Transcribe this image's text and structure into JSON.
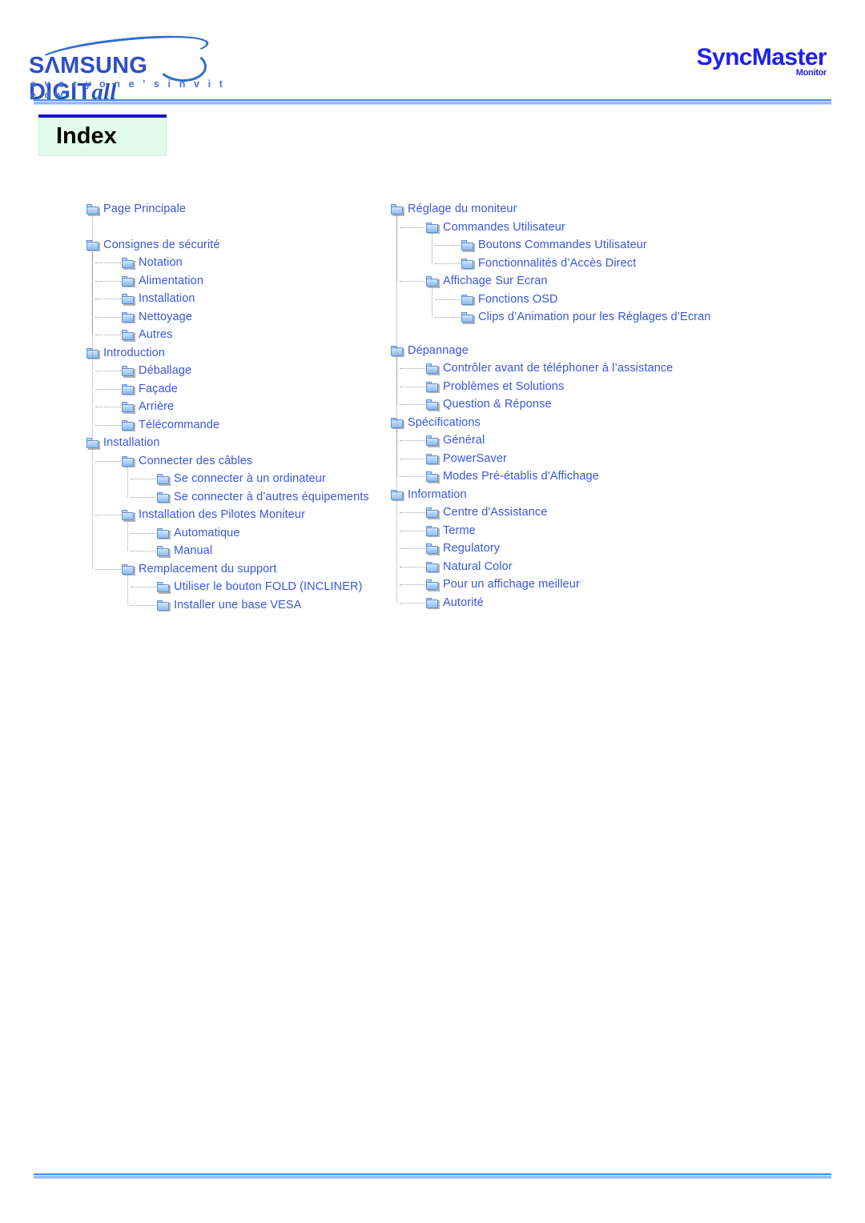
{
  "header": {
    "samsung_logo": {
      "wordmark_main": "SΛMSUNG DIGIT",
      "wordmark_italic": "all",
      "tagline": "e v e r y o n e ' s   i n v i t e d",
      "tagline_tm": "TM",
      "icon": "samsung-swoosh-icon"
    },
    "syncmaster_logo": {
      "name": "SyncMaster",
      "sub": "Monitor"
    }
  },
  "page_title": "Index",
  "colors": {
    "link": "#3a56dd",
    "rule_blue": "#4a90e8",
    "title_bar": "#1414cc",
    "title_bg": "#e3faee",
    "folder_fill": "#a9cdf5"
  },
  "tree": {
    "left_column": [
      {
        "level": 0,
        "label": "Page Principale"
      },
      {
        "level": 0,
        "label": "Consignes de sécurité"
      },
      {
        "level": 1,
        "label": "Notation"
      },
      {
        "level": 1,
        "label": "Alimentation"
      },
      {
        "level": 1,
        "label": "Installation"
      },
      {
        "level": 1,
        "label": "Nettoyage"
      },
      {
        "level": 1,
        "label": "Autres"
      },
      {
        "level": 0,
        "label": "Introduction"
      },
      {
        "level": 1,
        "label": "Déballage"
      },
      {
        "level": 1,
        "label": "Façade"
      },
      {
        "level": 1,
        "label": "Arrière"
      },
      {
        "level": 1,
        "label": "Télécommande"
      },
      {
        "level": 0,
        "label": "Installation"
      },
      {
        "level": 1,
        "label": "Connecter des câbles"
      },
      {
        "level": 2,
        "label": "Se connecter à un ordinateur"
      },
      {
        "level": 2,
        "label": "Se connecter à d’autres équipements"
      },
      {
        "level": 1,
        "label": "Installation des Pilotes Moniteur"
      },
      {
        "level": 2,
        "label": "Automatique"
      },
      {
        "level": 2,
        "label": "Manual"
      },
      {
        "level": 1,
        "label": "Remplacement du support"
      },
      {
        "level": 2,
        "label": "Utiliser le bouton FOLD (INCLINER)"
      },
      {
        "level": 2,
        "label": "Installer une base VESA"
      }
    ],
    "right_column": [
      {
        "level": 0,
        "label": "Réglage du moniteur"
      },
      {
        "level": 1,
        "label": "Commandes Utilisateur"
      },
      {
        "level": 2,
        "label": "Boutons Commandes Utilisateur"
      },
      {
        "level": 2,
        "label": "Fonctionnalités d’Accès Direct"
      },
      {
        "level": 1,
        "label": "Affichage Sur Ecran"
      },
      {
        "level": 2,
        "label": "Fonctions OSD"
      },
      {
        "level": 2,
        "label": "Clips d’Animation pour les Réglages d’Ecran"
      },
      {
        "level": 0,
        "label": "Dépannage"
      },
      {
        "level": 1,
        "label": "Contrôler avant de téléphoner à l’assistance"
      },
      {
        "level": 1,
        "label": "Problèmes et Solutions"
      },
      {
        "level": 1,
        "label": "Question & Réponse"
      },
      {
        "level": 0,
        "label": "Spécifications"
      },
      {
        "level": 1,
        "label": "Général"
      },
      {
        "level": 1,
        "label": "PowerSaver"
      },
      {
        "level": 1,
        "label": "Modes Pré-établis d'Affichage"
      },
      {
        "level": 0,
        "label": "Information"
      },
      {
        "level": 1,
        "label": "Centre d'Assistance"
      },
      {
        "level": 1,
        "label": "Terme"
      },
      {
        "level": 1,
        "label": "Regulatory"
      },
      {
        "level": 1,
        "label": "Natural Color"
      },
      {
        "level": 1,
        "label": "Pour un affichage meilleur"
      },
      {
        "level": 1,
        "label": "Autorité"
      }
    ]
  }
}
